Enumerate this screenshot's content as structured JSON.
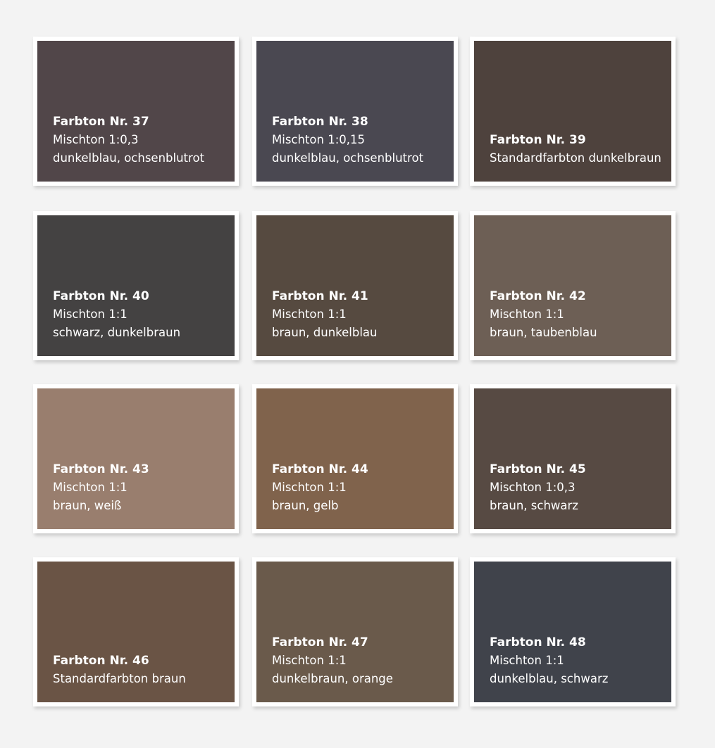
{
  "swatches": [
    {
      "title": "Farbton Nr. 37",
      "line1": "Mischton 1:0,3",
      "line2": "dunkelblau, ochsenblutrot",
      "color": "#514649"
    },
    {
      "title": "Farbton Nr. 38",
      "line1": "Mischton 1:0,15",
      "line2": "dunkelblau, ochsenblutrot",
      "color": "#4a4851"
    },
    {
      "title": "Farbton Nr. 39",
      "line1": "Standardfarbton dunkelbraun",
      "line2": "",
      "color": "#4e423d"
    },
    {
      "title": "Farbton Nr. 40",
      "line1": "Mischton 1:1",
      "line2": "schwarz, dunkelbraun",
      "color": "#444242"
    },
    {
      "title": "Farbton Nr. 41",
      "line1": "Mischton 1:1",
      "line2": "braun, dunkelblau",
      "color": "#564a40"
    },
    {
      "title": "Farbton Nr. 42",
      "line1": "Mischton 1:1",
      "line2": "braun, taubenblau",
      "color": "#6d5f55"
    },
    {
      "title": "Farbton Nr. 43",
      "line1": "Mischton 1:1",
      "line2": "braun, weiß",
      "color": "#997e6e"
    },
    {
      "title": "Farbton Nr. 44",
      "line1": "Mischton 1:1",
      "line2": "braun, gelb",
      "color": "#80634c"
    },
    {
      "title": "Farbton Nr. 45",
      "line1": "Mischton 1:0,3",
      "line2": "braun, schwarz",
      "color": "#574a43"
    },
    {
      "title": "Farbton Nr. 46",
      "line1": "Standardfarbton braun",
      "line2": "",
      "color": "#6a5445"
    },
    {
      "title": "Farbton Nr. 47",
      "line1": "Mischton 1:1",
      "line2": "dunkelbraun, orange",
      "color": "#6a5a4b"
    },
    {
      "title": "Farbton Nr. 48",
      "line1": "Mischton 1:1",
      "line2": "dunkelblau, schwarz",
      "color": "#40434b"
    }
  ]
}
